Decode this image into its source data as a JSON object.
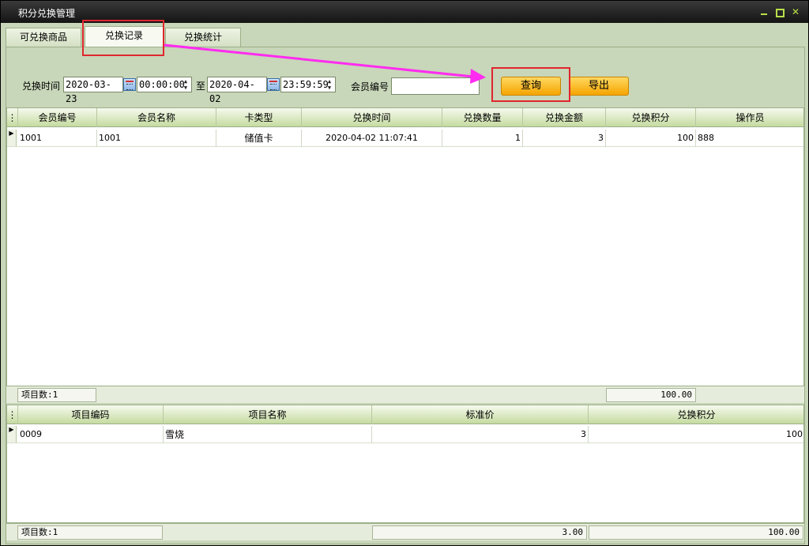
{
  "window": {
    "title": "积分兑换管理"
  },
  "tabs": [
    {
      "label": "可兑换商品"
    },
    {
      "label": "兑换记录"
    },
    {
      "label": "兑换统计"
    }
  ],
  "filter": {
    "time_label": "兑换时间",
    "start_date": "2020-03-23",
    "start_time": "00:00:00",
    "to_label": "至",
    "end_date": "2020-04-02",
    "end_time": "23:59:59",
    "member_label": "会员编号",
    "member_value": "",
    "query_label": "查询",
    "export_label": "导出"
  },
  "records": {
    "columns": [
      "会员编号",
      "会员名称",
      "卡类型",
      "兑换时间",
      "兑换数量",
      "兑换金额",
      "兑换积分",
      "操作员"
    ],
    "rows": [
      [
        "1001",
        "1001",
        "储值卡",
        "2020-04-02 11:07:41",
        "1",
        "3",
        "100",
        "888"
      ]
    ],
    "footer_count": "项目数:1",
    "footer_total": "100.00"
  },
  "items": {
    "columns": [
      "项目编码",
      "项目名称",
      "标准价",
      "兑换积分"
    ],
    "rows": [
      [
        "0009",
        "雪烧",
        "3",
        "100"
      ]
    ],
    "footer_count": "项目数:1",
    "footer_price": "3.00",
    "footer_points": "100.00"
  },
  "colors": {
    "accent_red": "#e0262e",
    "arrow_magenta": "#ff2bf0",
    "button_orange": "#f5a400"
  }
}
